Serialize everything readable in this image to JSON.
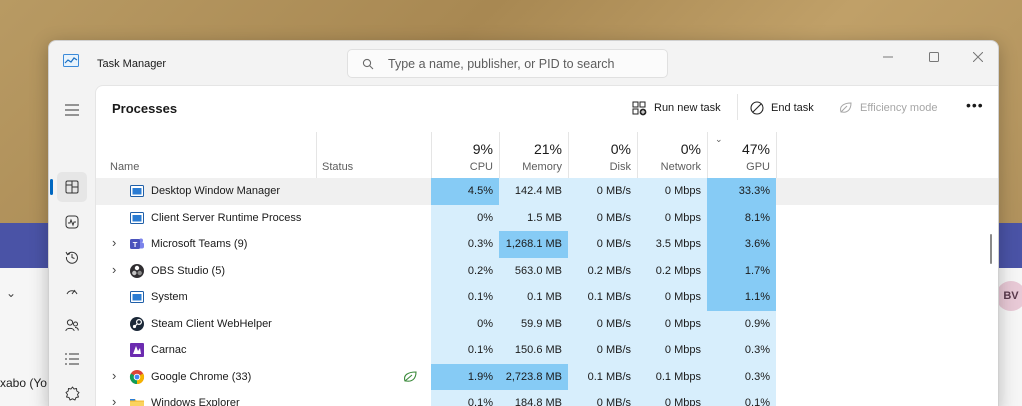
{
  "background": {
    "partial_text": "xabo (Yo",
    "avatar_initials": "BV",
    "chevron_icon": "chevron-down-icon"
  },
  "window": {
    "title": "Task Manager",
    "search_placeholder": "Type a name, publisher, or PID to search"
  },
  "nav": {
    "items": [
      {
        "name": "hamburger-menu-icon"
      },
      {
        "name": "processes-icon"
      },
      {
        "name": "performance-icon"
      },
      {
        "name": "app-history-icon"
      },
      {
        "name": "startup-apps-icon"
      },
      {
        "name": "users-icon"
      },
      {
        "name": "details-icon"
      },
      {
        "name": "services-icon"
      }
    ]
  },
  "toolbar": {
    "page_title": "Processes",
    "run_new_task": "Run new task",
    "end_task": "End task",
    "efficiency_mode": "Efficiency mode",
    "more": "•••"
  },
  "columns": {
    "name": "Name",
    "status": "Status",
    "cpu": {
      "pct": "9%",
      "label": "CPU"
    },
    "memory": {
      "pct": "21%",
      "label": "Memory"
    },
    "disk": {
      "pct": "0%",
      "label": "Disk"
    },
    "network": {
      "pct": "0%",
      "label": "Network"
    },
    "gpu": {
      "pct": "47%",
      "label": "GPU"
    }
  },
  "processes": [
    {
      "name": "Desktop Window Manager",
      "expandable": false,
      "icon": "window-app-icon",
      "cpu": "4.5%",
      "memory": "142.4 MB",
      "disk": "0 MB/s",
      "network": "0 Mbps",
      "gpu": "33.3%"
    },
    {
      "name": "Client Server Runtime Process",
      "expandable": false,
      "icon": "window-app-icon",
      "cpu": "0%",
      "memory": "1.5 MB",
      "disk": "0 MB/s",
      "network": "0 Mbps",
      "gpu": "8.1%"
    },
    {
      "name": "Microsoft Teams (9)",
      "expandable": true,
      "icon": "teams-icon",
      "cpu": "0.3%",
      "memory": "1,268.1 MB",
      "disk": "0 MB/s",
      "network": "3.5 Mbps",
      "gpu": "3.6%"
    },
    {
      "name": "OBS Studio (5)",
      "expandable": true,
      "icon": "obs-icon",
      "cpu": "0.2%",
      "memory": "563.0 MB",
      "disk": "0.2 MB/s",
      "network": "0.2 Mbps",
      "gpu": "1.7%"
    },
    {
      "name": "System",
      "expandable": false,
      "icon": "window-app-icon",
      "cpu": "0.1%",
      "memory": "0.1 MB",
      "disk": "0.1 MB/s",
      "network": "0 Mbps",
      "gpu": "1.1%"
    },
    {
      "name": "Steam Client WebHelper",
      "expandable": false,
      "icon": "steam-icon",
      "cpu": "0%",
      "memory": "59.9 MB",
      "disk": "0 MB/s",
      "network": "0 Mbps",
      "gpu": "0.9%"
    },
    {
      "name": "Carnac",
      "expandable": false,
      "icon": "carnac-icon",
      "cpu": "0.1%",
      "memory": "150.6 MB",
      "disk": "0 MB/s",
      "network": "0 Mbps",
      "gpu": "0.3%"
    },
    {
      "name": "Google Chrome (33)",
      "expandable": true,
      "icon": "chrome-icon",
      "status_icon": "efficiency-leaf-icon",
      "cpu": "1.9%",
      "memory": "2,723.8 MB",
      "disk": "0.1 MB/s",
      "network": "0.1 Mbps",
      "gpu": "0.3%"
    },
    {
      "name": "Windows Explorer",
      "expandable": true,
      "icon": "folder-icon",
      "cpu": "0.1%",
      "memory": "184.8 MB",
      "disk": "0 MB/s",
      "network": "0 Mbps",
      "gpu": "0.1%"
    }
  ],
  "heat_colors": {
    "light": "#d7eefc",
    "medium": "#bfe3fa",
    "strong": "#86cbf5"
  }
}
